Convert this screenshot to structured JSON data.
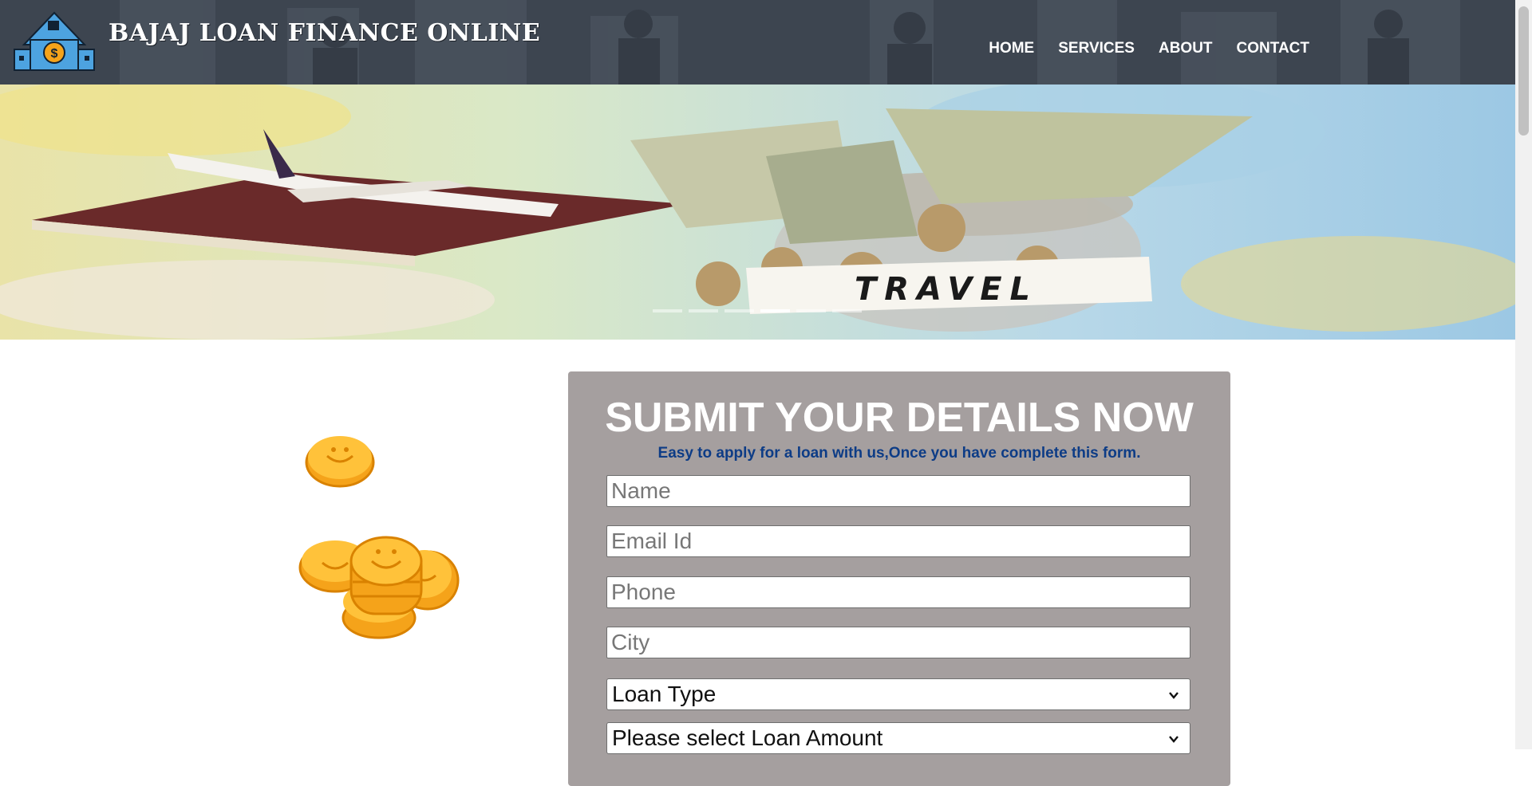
{
  "header": {
    "brand": "BAJAJ LOAN FINANCE ONLINE",
    "logo_icon": "house-dollar-icon",
    "nav": [
      {
        "label": "HOME"
      },
      {
        "label": "SERVICES"
      },
      {
        "label": "ABOUT"
      },
      {
        "label": "CONTACT"
      }
    ]
  },
  "banner": {
    "image_label": "TRAVEL",
    "slide_count": 6,
    "active_slide": 4
  },
  "form": {
    "title": "SUBMIT YOUR DETAILS NOW",
    "subtitle": "Easy to apply for a loan with us,Once you have complete this form.",
    "name_placeholder": "Name",
    "email_placeholder": "Email Id",
    "phone_placeholder": "Phone",
    "city_placeholder": "City",
    "loan_type": "Loan Type",
    "loan_amount": "Please select Loan Amount"
  },
  "colors": {
    "header_bg": "#3d4550",
    "form_bg": "#a59f9f",
    "subtitle": "#0d3c86",
    "coin": "#f5a31a"
  }
}
